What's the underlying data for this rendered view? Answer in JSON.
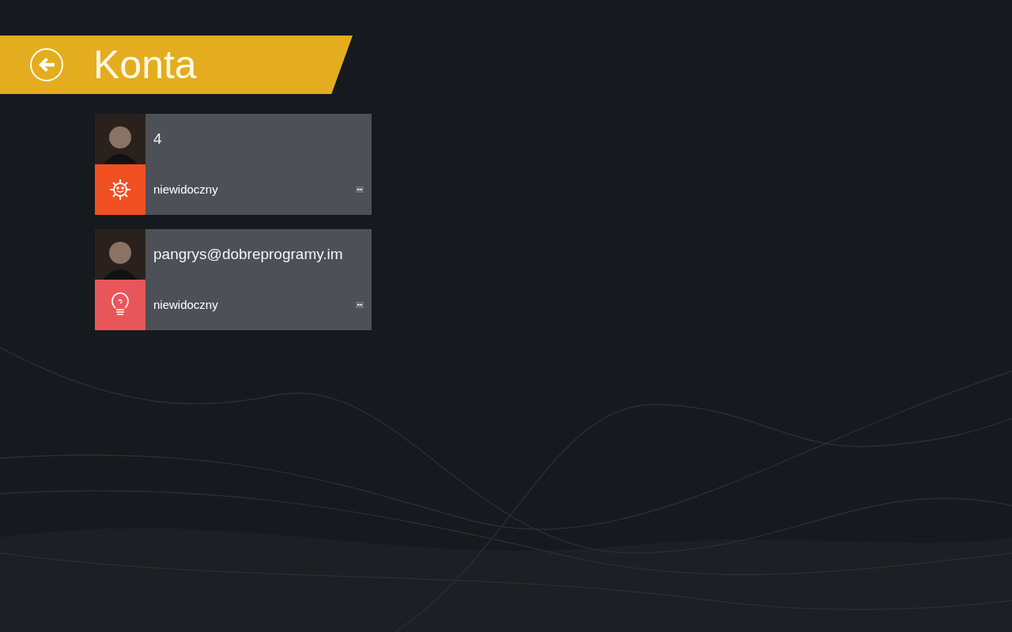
{
  "header": {
    "title": "Konta"
  },
  "accounts": [
    {
      "name": "4",
      "status": "niewidoczny",
      "kind": "sun",
      "color": "#f05022"
    },
    {
      "name": "pangrys@dobreprogramy.im",
      "status": "niewidoczny",
      "kind": "bulb",
      "color": "#e8565a"
    }
  ]
}
